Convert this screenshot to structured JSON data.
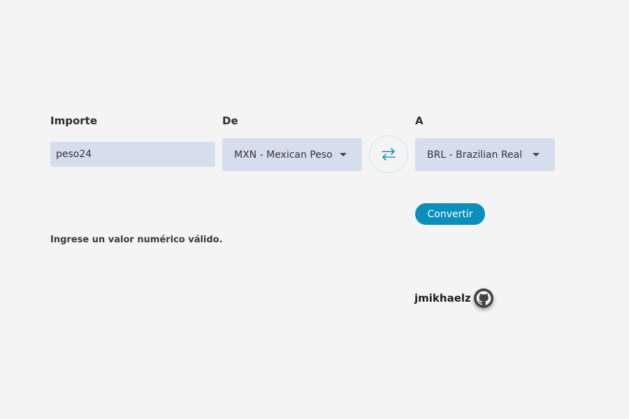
{
  "form": {
    "amount_label": "Importe",
    "amount_value": "peso24",
    "from_label": "De",
    "from_selected": "MXN - Mexican Peso",
    "to_label": "A",
    "to_selected": "BRL - Brazilian Real",
    "swap_icon": "swap-arrows-icon",
    "convert_label": "Convertir"
  },
  "error": {
    "message": "Ingrese un valor numérico válido."
  },
  "footer": {
    "author": "jmikhaelz",
    "author_icon": "github-icon"
  },
  "colors": {
    "background": "#f4f4f4",
    "field_bg": "#d6deee",
    "accent": "#0a8fbd"
  }
}
